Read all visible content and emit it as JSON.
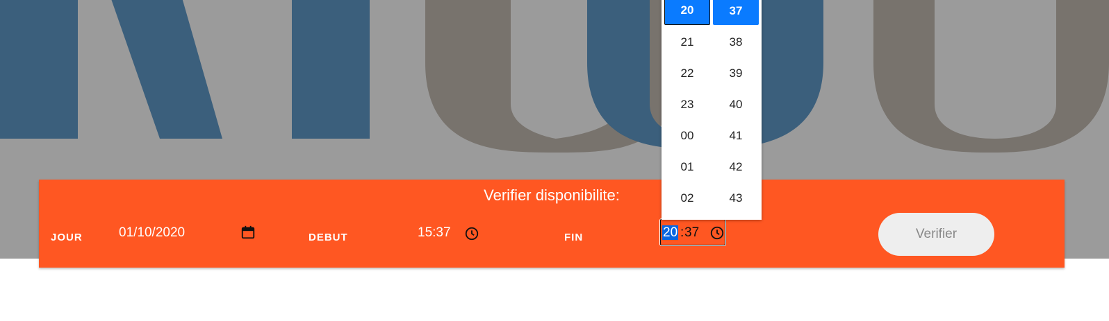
{
  "bar": {
    "title": "Verifier disponibilite:",
    "jour_label": "JOUR",
    "jour_value": "01/10/2020",
    "debut_label": "DEBUT",
    "debut_value": "15:37",
    "fin_label": "FIN",
    "fin_hour": "20",
    "fin_sep": ":",
    "fin_minute": "37",
    "button": "Verifier"
  },
  "picker": {
    "hours": [
      "20",
      "21",
      "22",
      "23",
      "00",
      "01",
      "02"
    ],
    "minutes": [
      "37",
      "38",
      "39",
      "40",
      "41",
      "42",
      "43"
    ],
    "selected_hour": "20",
    "selected_minute": "37"
  },
  "colors": {
    "accent": "#ff5722",
    "selection": "#0a7bff",
    "hero": "#9b9b9b"
  },
  "icons": [
    "calendar-icon",
    "clock-icon"
  ]
}
